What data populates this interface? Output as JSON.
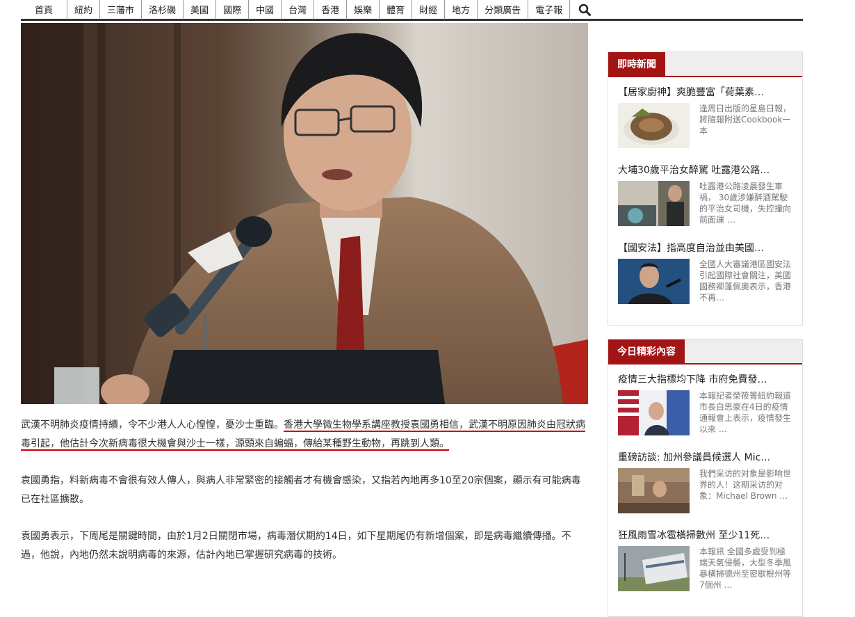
{
  "nav": {
    "items": [
      "首頁",
      "紐約",
      "三藩市",
      "洛杉磯",
      "美國",
      "國際",
      "中國",
      "台灣",
      "香港",
      "娛樂",
      "體育",
      "財經",
      "地方",
      "分類廣告",
      "電子報"
    ],
    "search_icon": "search-icon"
  },
  "article": {
    "p1_before": "武漢不明肺炎疫情持續，令不少港人人心惶惶，憂沙士重臨。",
    "p1_highlight": "香港大學微生物學系講座教授袁國勇相信，武漢不明原因肺炎由冠狀病毒引起，他估計今次新病毒很大機會與沙士一樣，源頭來自蝙蝠，傳給某種野生動物，再跳到人類。",
    "p2": "袁國勇指，料新病毒不會很有效人傳人，與病人非常緊密的接觸者才有機會感染，又指若內地再多10至20宗個案，顯示有可能病毒已在社區擴散。",
    "p3": "袁國勇表示，下周尾是關鍵時間，由於1月2日關閉市場，病毒潛伏期約14日，如下星期尾仍有新增個案，即是病毒繼續傳播。不過，他說，內地仍然未說明病毒的來源，估計內地已掌握研究病毒的技術。",
    "highlight_color": "#cc0000"
  },
  "sidebar": {
    "accent": "#a31515",
    "box1": {
      "title": "即時新聞",
      "items": [
        {
          "title": "【居家廚神】爽脆豐富「荷葉素…",
          "snippet": "逢周日出版的星島日報，將隨報附送Cookbook一本"
        },
        {
          "title": "大埔30歲平治女醉駕 吐露港公路…",
          "snippet": "吐露港公路凌晨發生車禍， 30歲涉嫌醉酒駕駛的平治女司機，失控撞向前面運 …"
        },
        {
          "title": "【國安法】指高度自治並由美國…",
          "snippet": "全國人大審議港區國安法引起國際社會關注，美國國務卿蓬佩奧表示，香港不再…"
        }
      ]
    },
    "box2": {
      "title": "今日精彩內容",
      "items": [
        {
          "title": "疫情三大指標均下降 市府免費發…",
          "snippet": "本報記者榮筱箐紐約報道 市長白思豪在4日的疫情通報會上表示，疫情發生以來 …"
        },
        {
          "title": "重磅訪談: 加州參議員候選人 Mic…",
          "snippet": "我們采访的对象是影响世界的人！这期采访的对象：Michael Brown …"
        },
        {
          "title": "狂風雨雪冰雹橫掃數州 至少11死…",
          "snippet": "本報訊 全國多處受到極端天氣侵襲，大型冬季風暴橫掃德州至密歇根州等7個州 …"
        }
      ]
    }
  }
}
